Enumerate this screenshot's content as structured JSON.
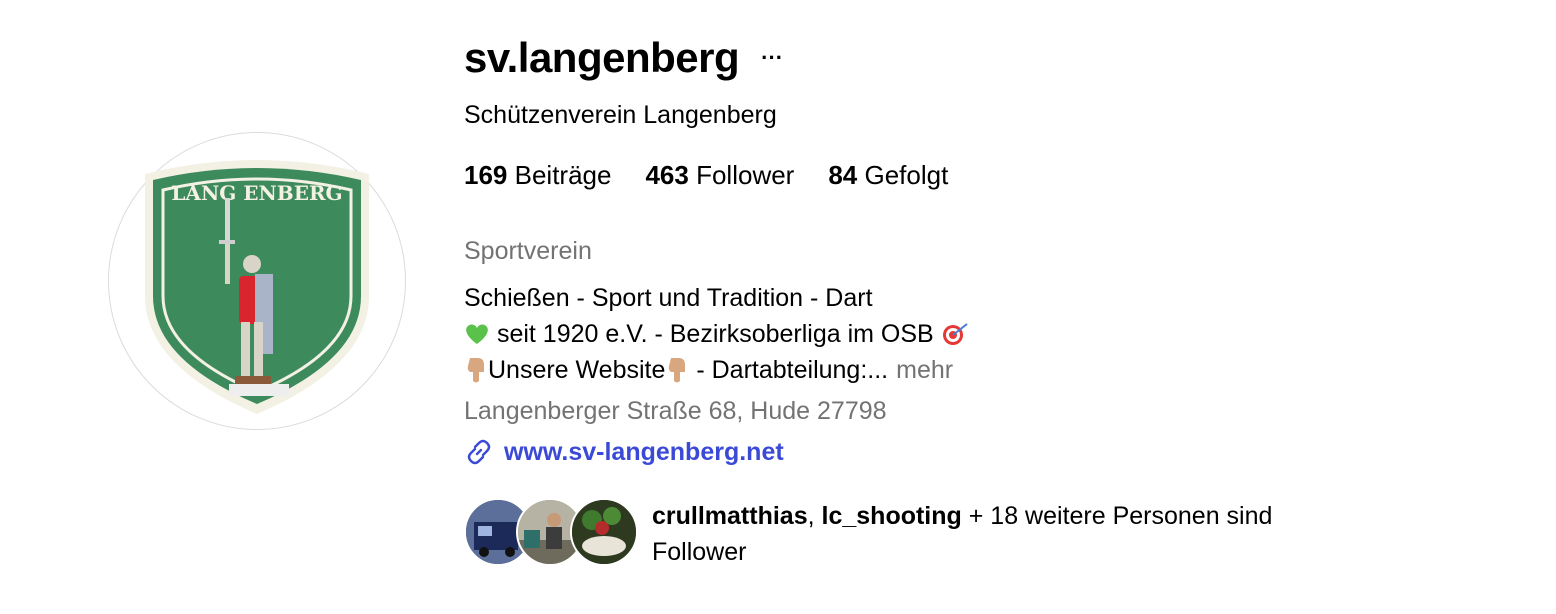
{
  "profile": {
    "username": "sv.langenberg",
    "more_icon": "···",
    "full_name": "Schützenverein Langenberg",
    "avatar_text": "LANGENBERG"
  },
  "stats": [
    {
      "count": "169",
      "label": "Beiträge"
    },
    {
      "count": "463",
      "label": "Follower"
    },
    {
      "count": "84",
      "label": "Gefolgt"
    }
  ],
  "bio": {
    "category": "Sportverein",
    "line1": "Schießen - Sport und Tradition - Dart",
    "line2": " seit 1920 e.V. - Bezirksoberliga im OSB ",
    "line3_a": "Unsere Website",
    "line3_b": " - Dartabteilung:...",
    "more_label": "mehr",
    "address": "Langenberger Straße 68, Hude 27798"
  },
  "website": {
    "label": "www.sv-langenberg.net",
    "icon": "link-icon"
  },
  "followed_by": {
    "user1": "crullmatthias",
    "separator": ", ",
    "user2": "lc_shooting",
    "suffix": " + 18 weitere Personen sind Follower"
  },
  "colors": {
    "shield_green": "#3d8a5c",
    "link_blue": "#3b4ad6",
    "muted_gray": "#737373"
  }
}
